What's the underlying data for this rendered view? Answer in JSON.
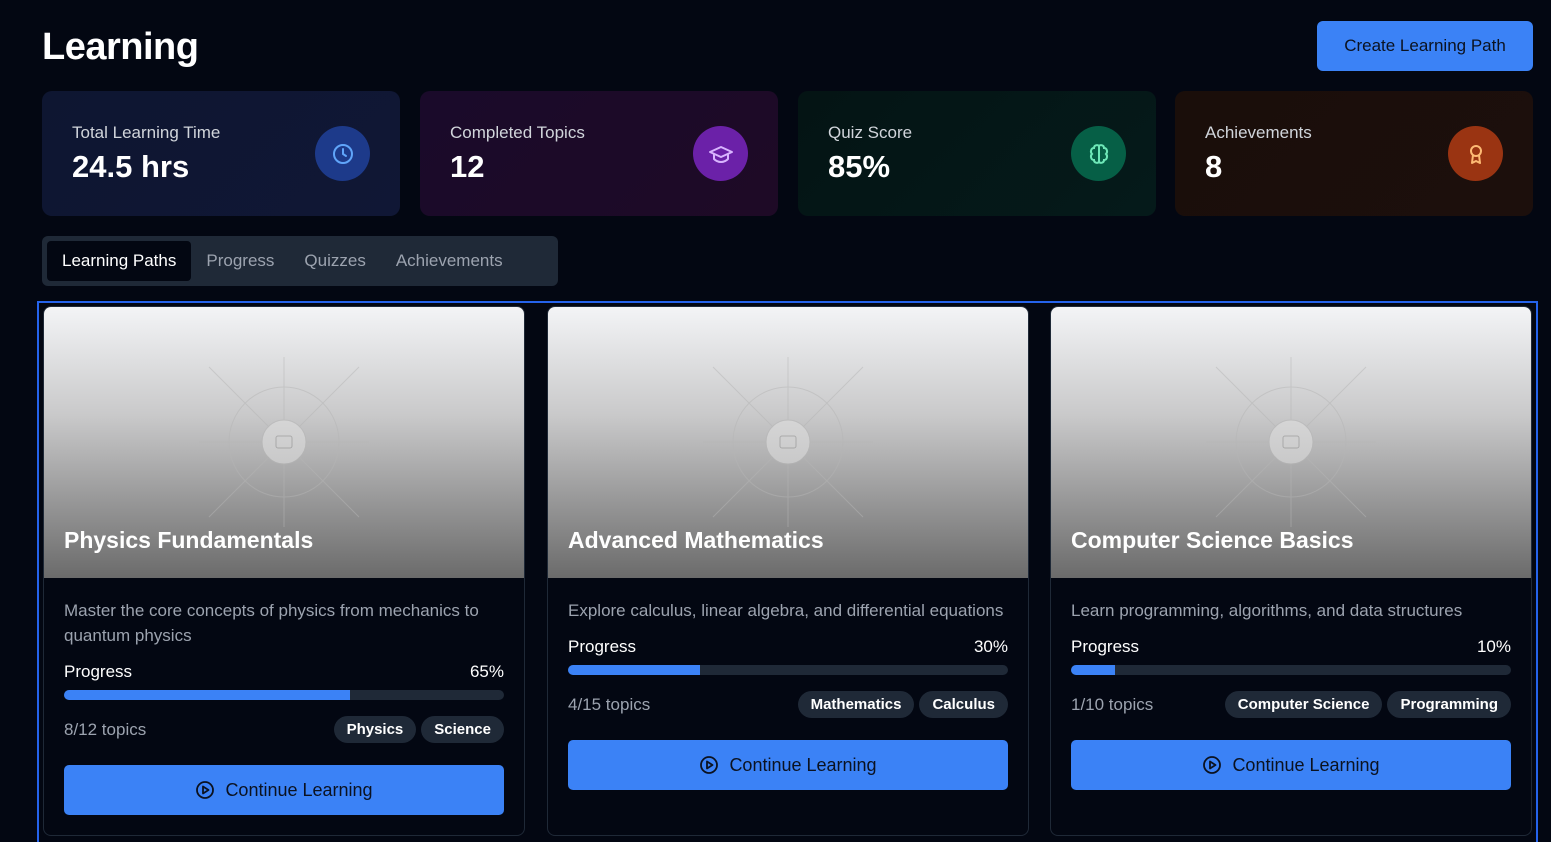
{
  "header": {
    "title": "Learning",
    "create_button": "Create Learning Path"
  },
  "stats": [
    {
      "label": "Total Learning Time",
      "value": "24.5 hrs",
      "icon": "clock-icon",
      "accent": "#1d3a8a"
    },
    {
      "label": "Completed Topics",
      "value": "12",
      "icon": "graduation-cap-icon",
      "accent": "#6b21a8"
    },
    {
      "label": "Quiz Score",
      "value": "85%",
      "icon": "brain-icon",
      "accent": "#065f46"
    },
    {
      "label": "Achievements",
      "value": "8",
      "icon": "award-icon",
      "accent": "#9a3412"
    }
  ],
  "tabs": [
    {
      "label": "Learning Paths",
      "active": true
    },
    {
      "label": "Progress",
      "active": false
    },
    {
      "label": "Quizzes",
      "active": false
    },
    {
      "label": "Achievements",
      "active": false
    }
  ],
  "cards": [
    {
      "title": "Physics Fundamentals",
      "description": "Master the core concepts of physics from mechanics to quantum physics",
      "progress_label": "Progress",
      "progress_text": "65%",
      "progress": 0.65,
      "topics": "8/12 topics",
      "tags": [
        "Physics",
        "Science"
      ],
      "button": "Continue Learning"
    },
    {
      "title": "Advanced Mathematics",
      "description": "Explore calculus, linear algebra, and differential equations",
      "progress_label": "Progress",
      "progress_text": "30%",
      "progress": 0.3,
      "topics": "4/15 topics",
      "tags": [
        "Mathematics",
        "Calculus"
      ],
      "button": "Continue Learning"
    },
    {
      "title": "Computer Science Basics",
      "description": "Learn programming, algorithms, and data structures",
      "progress_label": "Progress",
      "progress_text": "10%",
      "progress": 0.1,
      "topics": "1/10 topics",
      "tags": [
        "Computer Science",
        "Programming"
      ],
      "button": "Continue Learning"
    }
  ],
  "colors": {
    "accent": "#3b82f6",
    "background": "#030712",
    "frame": "#2563eb"
  }
}
